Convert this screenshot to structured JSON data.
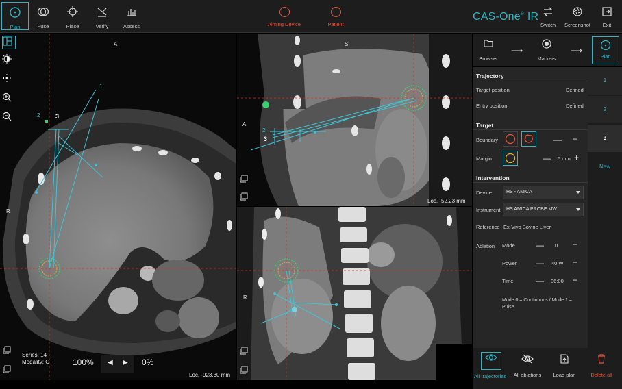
{
  "toolbar": {
    "tools": [
      {
        "label": "Plan",
        "icon": "plan-icon",
        "active": true
      },
      {
        "label": "Fuse",
        "icon": "fuse-icon"
      },
      {
        "label": "Place",
        "icon": "place-icon"
      },
      {
        "label": "Verify",
        "icon": "verify-icon"
      },
      {
        "label": "Assess",
        "icon": "assess-icon"
      }
    ],
    "aiming_device": "Aiming Device",
    "patient": "Patient",
    "brand": "CAS-One",
    "brand_sup": "®",
    "brand_suffix": "IR",
    "switch": "Switch",
    "screenshot": "Screenshot",
    "exit": "Exit"
  },
  "viewports": {
    "axial": {
      "top": "A",
      "left": "R",
      "series": "Series: 14",
      "modality": "Modality: CT",
      "loc": "Loc. -923.30 mm",
      "labels": [
        "1",
        "2",
        "3"
      ]
    },
    "sagittal": {
      "top": "S",
      "left": "A",
      "loc": "Loc. -52.23 mm",
      "labels": [
        "2",
        "3"
      ]
    },
    "coronal": {
      "left": "R"
    }
  },
  "bottom": {
    "zoom": "100%",
    "opacity": "0%"
  },
  "workflow": {
    "browser": "Browser",
    "markers": "Markers",
    "plan": "Plan"
  },
  "trajectory": {
    "title": "Trajectory",
    "target_label": "Target position",
    "target_value": "Defined",
    "entry_label": "Entry position",
    "entry_value": "Defined"
  },
  "target": {
    "title": "Target",
    "boundary": "Boundary",
    "margin": "Margin",
    "margin_value": "5 mm"
  },
  "intervention": {
    "title": "Intervention",
    "device_label": "Device",
    "device_value": "HS - AMICA",
    "instrument_label": "Instrument",
    "instrument_value": "HS AMICA PROBE MW",
    "reference_label": "Reference",
    "reference_value": "Ex-Vivo Bovine Liver",
    "ablation_label": "Ablation",
    "mode_label": "Mode",
    "mode_value": "0",
    "power_label": "Power",
    "power_value": "40 W",
    "time_label": "Time",
    "time_value": "06:00",
    "note": "Mode 0 = Continuous / Mode 1 = Pulse"
  },
  "plans": [
    "1",
    "2",
    "3",
    "New"
  ],
  "actions": {
    "all_trajectories": "All trajectories",
    "all_ablations": "All ablations",
    "load_plan": "Load plan",
    "delete_all": "Delete all"
  },
  "colors": {
    "accent": "#2fb3c3",
    "warning": "#e0573f"
  }
}
